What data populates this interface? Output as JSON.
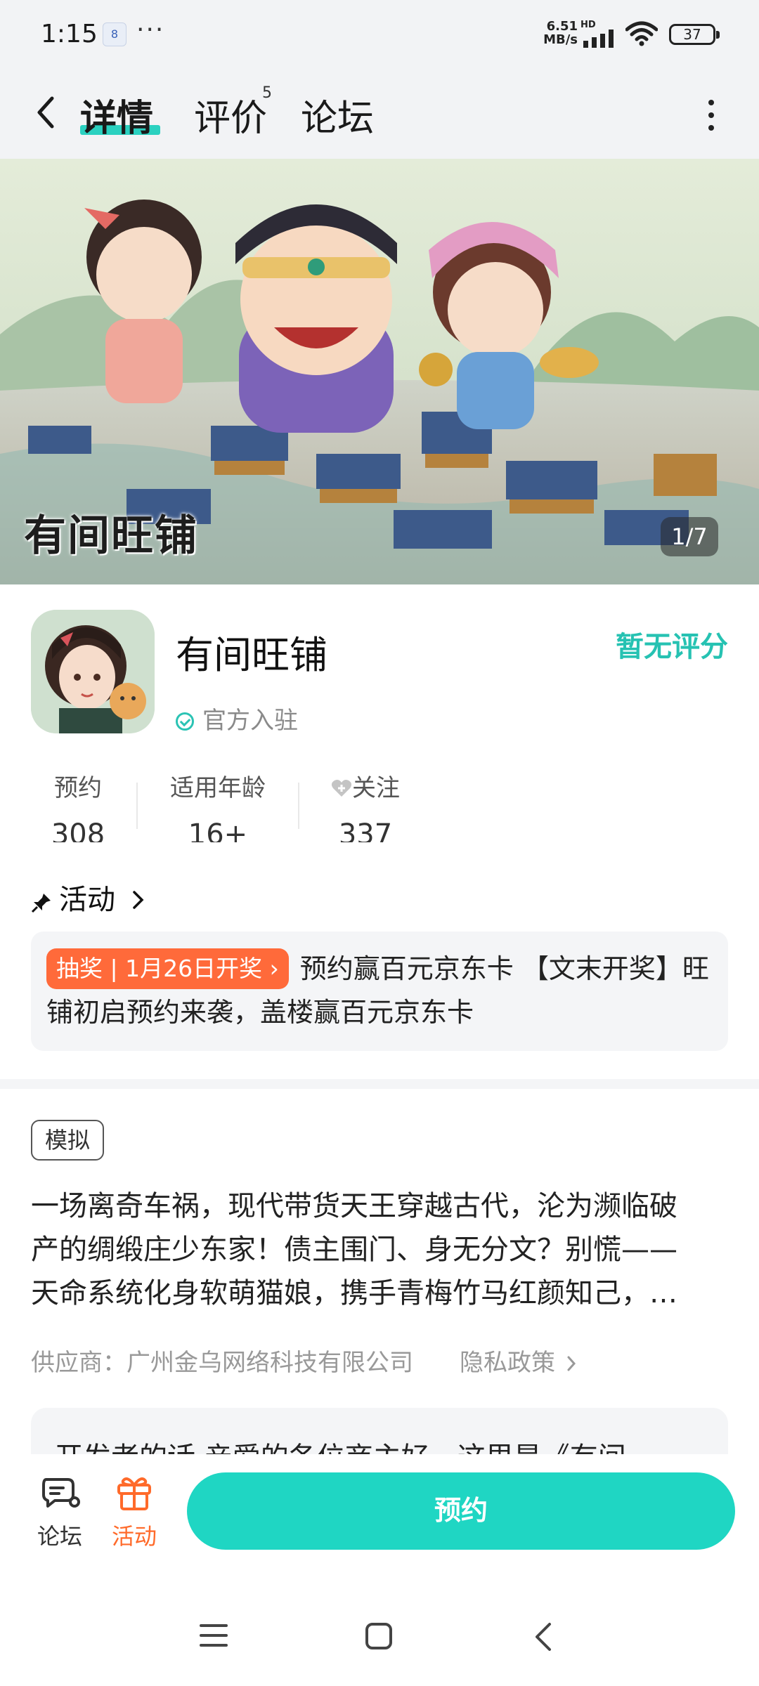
{
  "status_bar": {
    "time": "1:15",
    "notification_badge": "8",
    "dots": "···",
    "net_speed_value": "6.51",
    "net_speed_unit": "MB/s",
    "hd": "HD",
    "battery": "37"
  },
  "nav": {
    "tabs": [
      {
        "label": "详情"
      },
      {
        "label": "评价"
      },
      {
        "label": "论坛"
      }
    ],
    "review_count": "5",
    "accent_color": "#2bd1c0"
  },
  "banner": {
    "logo_text": "有间旺铺",
    "counter": "1/7"
  },
  "app": {
    "name": "有间旺铺",
    "official_label": "官方入驻",
    "rating_text": "暂无评分",
    "stats": [
      {
        "label": "预约",
        "value": "308"
      },
      {
        "label": "适用年龄",
        "value": "16+"
      },
      {
        "label": "关注",
        "value": "337"
      }
    ]
  },
  "activities": {
    "title": "活动",
    "tag": "抽奖 | 1月26日开奖",
    "text": "预约赢百元京东卡 【文末开奖】旺铺初启预约来袭，盖楼赢百元京东卡"
  },
  "details": {
    "tag": "模拟",
    "description_lines": [
      "一场离奇车祸，现代带货天王穿越古代，沦为濒临破",
      "产的绸缎庄少东家！债主围门、身无分文？别慌——",
      "天命系统化身软萌猫娘，携手青梅竹马红颜知己，…"
    ],
    "supplier": "供应商：广州金乌网络科技有限公司",
    "privacy": "隐私政策",
    "developer_note": "开发者的话 亲爱的各位商主好，这里是《有间"
  },
  "bottom_bar": {
    "forum_label": "论坛",
    "activity_label": "活动",
    "reserve_label": "预约",
    "activity_color": "#ff6a2a",
    "reserve_color": "#1fd6c3"
  }
}
